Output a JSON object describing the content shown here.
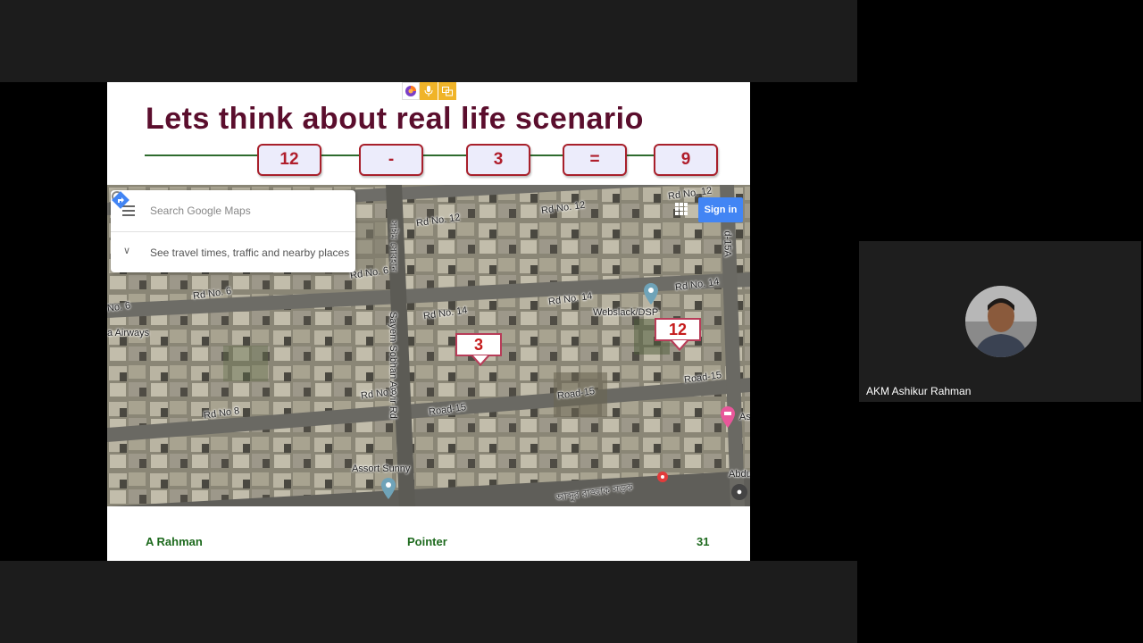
{
  "slide": {
    "title": "Lets think about real life scenario",
    "equation": [
      "12",
      "-",
      "3",
      "=",
      "9"
    ],
    "footer": {
      "author": "A Rahman",
      "topic": "Pointer",
      "page": "31"
    }
  },
  "share_toolbar": {
    "icons": [
      "firefox-icon",
      "microphone-icon",
      "window-share-icon"
    ]
  },
  "map": {
    "search_placeholder": "Search Google Maps",
    "expand_text": "See travel times, traffic and nearby places",
    "sign_in": "Sign in",
    "labels": {
      "rd12_a": "Rd No. 12",
      "rd12_b": "Rd No. 12",
      "rd12_c": "Rd No. 12",
      "rd15a": "d-15A",
      "rd6_a": "Rd No. 6",
      "rd6_b": "Rd No. 6",
      "rd6_c": "No. 6",
      "airways": "a Airways",
      "rd14_a": "Rd No. 14",
      "rd14_b": "Rd No. 14",
      "rd14_c": "Rd No. 14",
      "webslack": "Webslack/DSP",
      "sayem": "Sayem Sobhan Anvir Rd",
      "rd8_a": "Rd No 8",
      "rd8_b": "Rd No 8",
      "road15_a": "Road-15",
      "road15_b": "Road-15",
      "road15_c": "Road-15",
      "assort": "Assort Sunny",
      "bengali_road": "আব্দুর রাজ্জাক সড়ক",
      "bengali_vertical": "সাঈম সোবহান",
      "edge_as": "As",
      "edge_abdu": "Abdu"
    },
    "callouts": {
      "left": "3",
      "right": "12"
    }
  },
  "participant": {
    "name": "AKM Ashikur Rahman"
  }
}
